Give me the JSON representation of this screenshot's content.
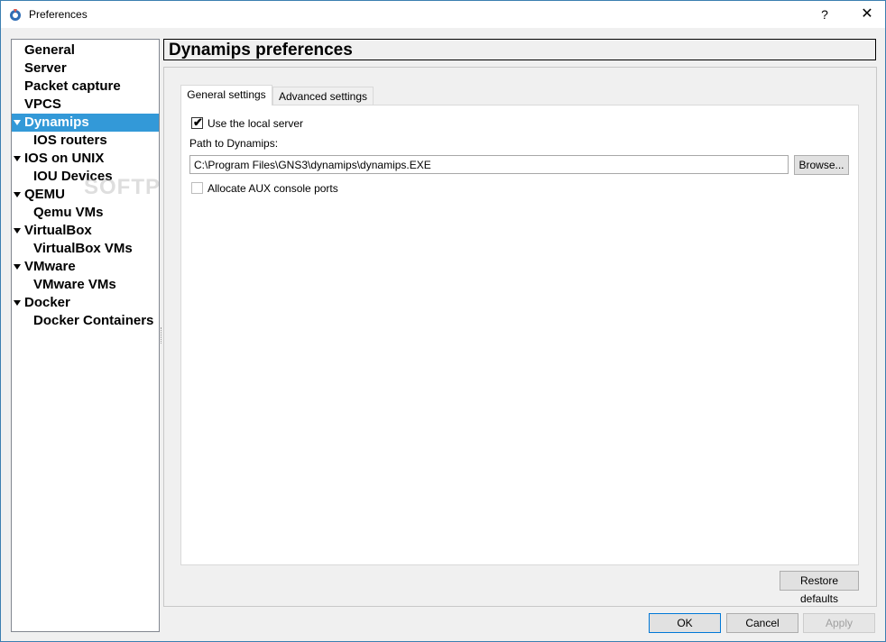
{
  "window": {
    "title": "Preferences",
    "help_label": "?",
    "close_label": "✕"
  },
  "nav": {
    "items": [
      {
        "label": "General"
      },
      {
        "label": "Server"
      },
      {
        "label": "Packet capture"
      },
      {
        "label": "VPCS"
      },
      {
        "label": "Dynamips"
      },
      {
        "label": "IOS routers"
      },
      {
        "label": "IOS on UNIX"
      },
      {
        "label": "IOU Devices"
      },
      {
        "label": "QEMU"
      },
      {
        "label": "Qemu VMs"
      },
      {
        "label": "VirtualBox"
      },
      {
        "label": "VirtualBox VMs"
      },
      {
        "label": "VMware"
      },
      {
        "label": "VMware VMs"
      },
      {
        "label": "Docker"
      },
      {
        "label": "Docker Containers"
      }
    ],
    "selected": "Dynamips",
    "watermark": "SOFTPEDIA"
  },
  "page": {
    "title": "Dynamips preferences",
    "tabs": [
      {
        "label": "General settings"
      },
      {
        "label": "Advanced settings"
      }
    ],
    "use_local_server": {
      "label": "Use the local server",
      "checked": true
    },
    "path_label": "Path to Dynamips:",
    "path_value": "C:\\Program Files\\GNS3\\dynamips\\dynamips.EXE",
    "browse_label": "Browse...",
    "aux_ports": {
      "label": "Allocate AUX console ports",
      "checked": false
    },
    "restore_label": "Restore defaults"
  },
  "footer": {
    "ok_label": "OK",
    "cancel_label": "Cancel",
    "apply_label": "Apply"
  },
  "colors": {
    "selection": "#3399d8",
    "window_border": "#3c7fb1"
  }
}
